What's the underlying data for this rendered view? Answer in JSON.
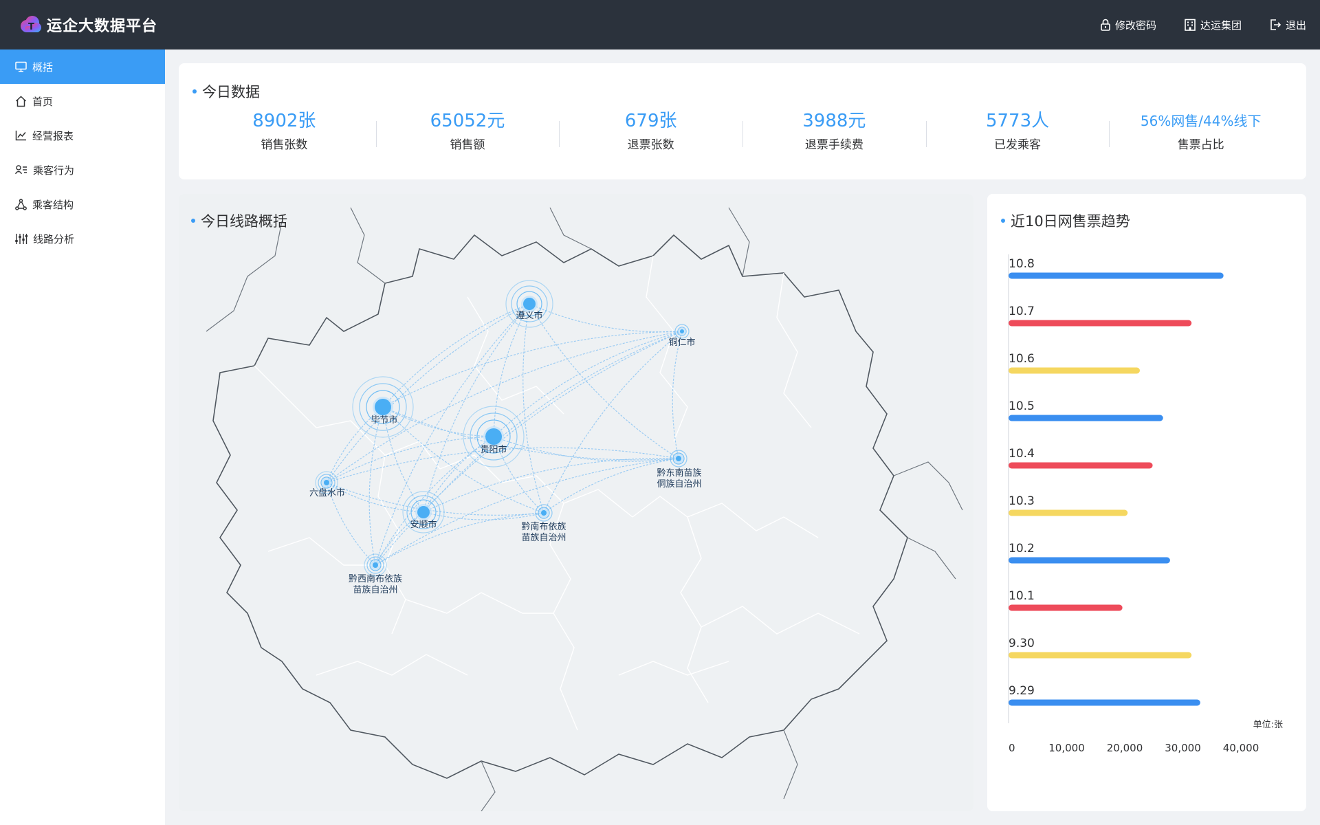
{
  "header": {
    "app_title": "运企大数据平台",
    "actions": {
      "change_password": "修改密码",
      "company": "达运集团",
      "logout": "退出"
    }
  },
  "sidebar": {
    "items": [
      {
        "label": "概括",
        "icon": "monitor-icon",
        "active": true
      },
      {
        "label": "首页",
        "icon": "home-icon"
      },
      {
        "label": "经营报表",
        "icon": "line-chart-icon"
      },
      {
        "label": "乘客行为",
        "icon": "user-list-icon"
      },
      {
        "label": "乘客结构",
        "icon": "share-icon"
      },
      {
        "label": "线路分析",
        "icon": "sliders-icon"
      }
    ]
  },
  "today": {
    "title": "今日数据",
    "stats": [
      {
        "value": "8902张",
        "label": "销售张数"
      },
      {
        "value": "65052元",
        "label": "销售额"
      },
      {
        "value": "679张",
        "label": "退票张数"
      },
      {
        "value": "3988元",
        "label": "退票手续费"
      },
      {
        "value": "5773人",
        "label": "已发乘客"
      },
      {
        "value": "56%网售/44%线下",
        "label": "售票占比"
      }
    ]
  },
  "route_map": {
    "title": "今日线路概括",
    "cities": [
      {
        "name": "遵义市",
        "lines": [
          "遵义市"
        ]
      },
      {
        "name": "铜仁市",
        "lines": [
          "铜仁市"
        ]
      },
      {
        "name": "毕节市",
        "lines": [
          "毕节市"
        ]
      },
      {
        "name": "贵阳市",
        "lines": [
          "贵阳市"
        ]
      },
      {
        "name": "黔东南苗族侗族自治州",
        "lines": [
          "黔东南苗族",
          "侗族自治州"
        ]
      },
      {
        "name": "六盘水市",
        "lines": [
          "六盘水市"
        ]
      },
      {
        "name": "安顺市",
        "lines": [
          "安顺市"
        ]
      },
      {
        "name": "黔南布依族苗族自治州",
        "lines": [
          "黔南布依族",
          "苗族自治州"
        ]
      },
      {
        "name": "黔西南布依族苗族自治州",
        "lines": [
          "黔西南布依族",
          "苗族自治州"
        ]
      }
    ]
  },
  "trend": {
    "title": "近10日网售票趋势",
    "unit_label": "单位:张",
    "colors": {
      "blue": "#3a8ef0",
      "red": "#ee4b5a",
      "yellow": "#f5d760"
    }
  },
  "chart_data": {
    "type": "bar",
    "orientation": "horizontal",
    "categories": [
      "10.8",
      "10.7",
      "10.6",
      "10.5",
      "10.4",
      "10.3",
      "10.2",
      "10.1",
      "9.30",
      "9.29"
    ],
    "values": [
      37000,
      31500,
      22600,
      26600,
      24800,
      20500,
      27800,
      19600,
      31500,
      33000
    ],
    "bar_colors": [
      "#3a8ef0",
      "#ee4b5a",
      "#f5d760",
      "#3a8ef0",
      "#ee4b5a",
      "#f5d760",
      "#3a8ef0",
      "#ee4b5a",
      "#f5d760",
      "#3a8ef0"
    ],
    "xlim": [
      0,
      40000
    ],
    "xticks": [
      "0",
      "10,000",
      "20,000",
      "30,000",
      "40,000"
    ],
    "title": "近10日网售票趋势",
    "xlabel": "单位:张",
    "ylabel": ""
  }
}
